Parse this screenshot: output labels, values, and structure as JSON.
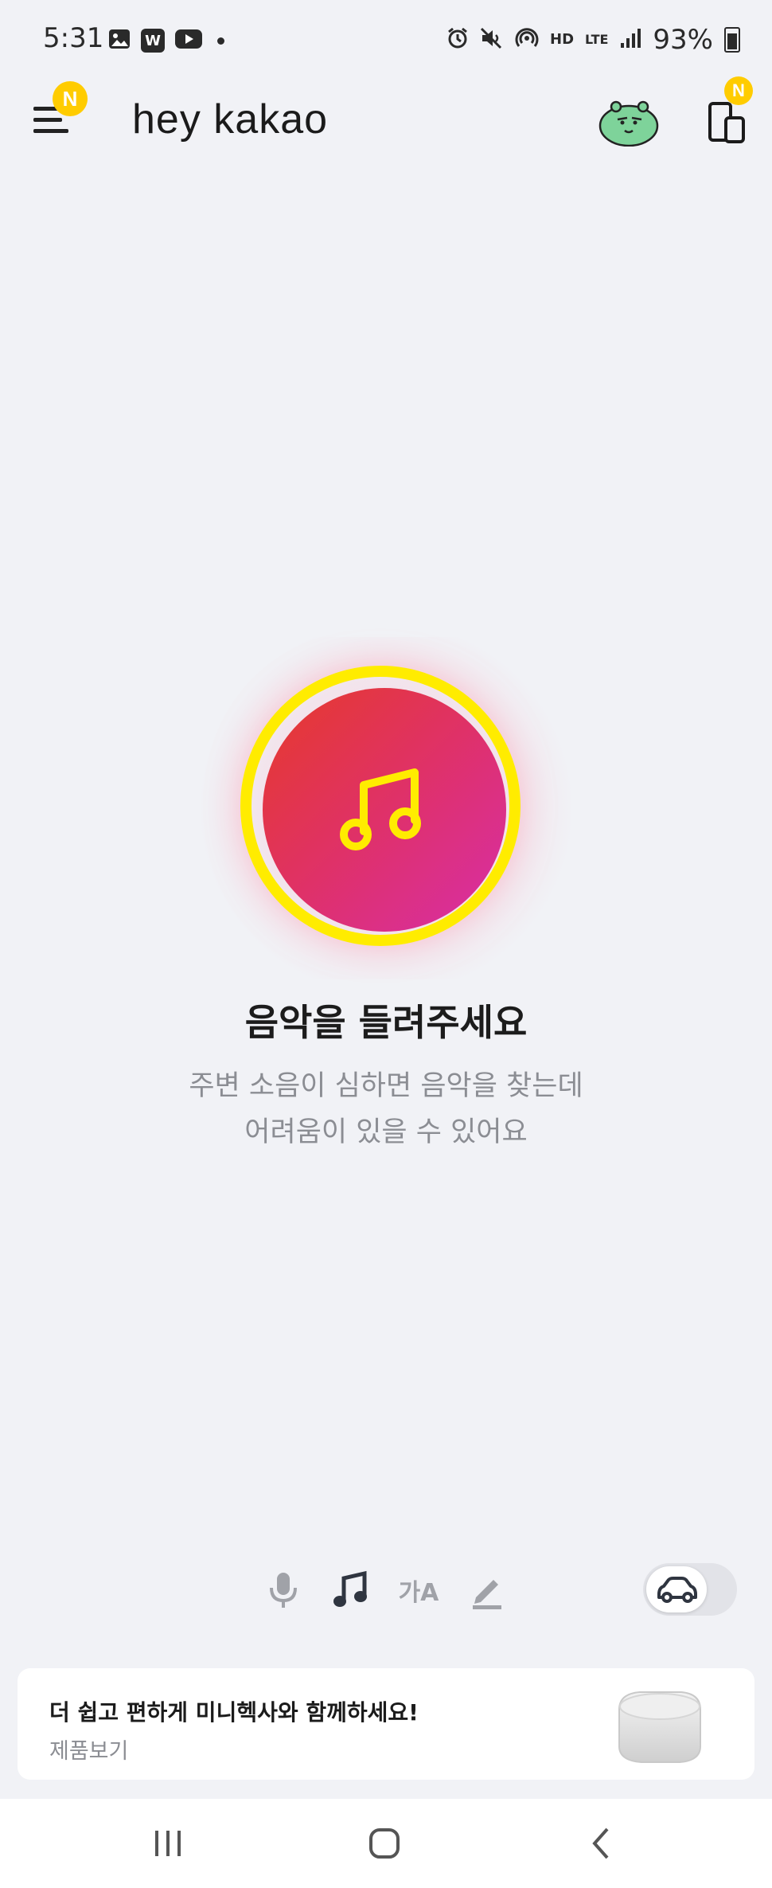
{
  "status_bar": {
    "time": "5:31",
    "left_icons": [
      "image-icon",
      "w-app-icon",
      "youtube-icon",
      "dot-icon"
    ],
    "w_label": "W",
    "right_icons": [
      "alarm-icon",
      "mute-icon",
      "hotspot-icon",
      "hd-voice-icon",
      "lte-icon",
      "signal-icon",
      "battery-icon"
    ],
    "hd_label": "HD",
    "lte_label": "LTE",
    "battery_percent": "93%"
  },
  "header": {
    "logo": "hey kakao",
    "menu_badge": "N",
    "device_badge": "N",
    "avatar_color": "#7ed39a"
  },
  "hero": {
    "title": "음악을 들려주세요",
    "subtitle_line1": "주변 소음이 심하면 음악을 찾는데",
    "subtitle_line2": "어려움이 있을 수 있어요",
    "ring_color": "#ffec00",
    "gradient_start": "#e63a2a",
    "gradient_end": "#d72ea8"
  },
  "modes": {
    "items": [
      "mic-icon",
      "music-note-icon",
      "translate-icon",
      "pen-icon"
    ],
    "active": "music-note-icon",
    "translate_glyph": "가A",
    "car_toggle": "car-icon"
  },
  "promo": {
    "title": "더 쉽고 편하게 미니헥사와 함께하세요!",
    "link": "제품보기"
  },
  "navbar": {
    "items": [
      "recent-apps-icon",
      "home-icon",
      "back-icon"
    ]
  }
}
